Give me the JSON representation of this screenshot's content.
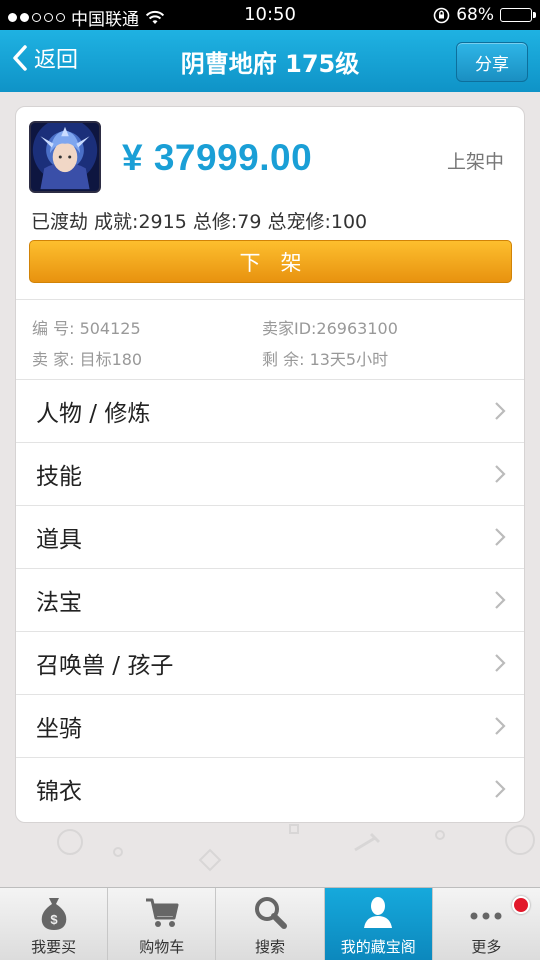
{
  "status_bar": {
    "carrier": "中国联通",
    "time": "10:50",
    "battery": "68%",
    "battery_level": 0.68
  },
  "nav": {
    "back_label": "返回",
    "title": "阴曹地府 175级",
    "share_label": "分享"
  },
  "item": {
    "price": "¥ 37999.00",
    "status": "上架中",
    "stats": "已渡劫  成就:2915  总修:79  总宠修:100",
    "action_label": "下架"
  },
  "meta": {
    "id_label": "编  号: 504125",
    "seller_id_label": "卖家ID:26963100",
    "seller_label": "卖  家: 目标180",
    "remaining_label": "剩  余: 13天5小时"
  },
  "menu": [
    {
      "label": "人物 / 修炼"
    },
    {
      "label": "技能"
    },
    {
      "label": "道具"
    },
    {
      "label": "法宝"
    },
    {
      "label": "召唤兽 / 孩子"
    },
    {
      "label": "坐骑"
    },
    {
      "label": "锦衣"
    }
  ],
  "tabs": [
    {
      "label": "我要买",
      "icon": "money-bag-icon"
    },
    {
      "label": "购物车",
      "icon": "cart-icon"
    },
    {
      "label": "搜索",
      "icon": "search-icon"
    },
    {
      "label": "我的藏宝阁",
      "icon": "user-icon"
    },
    {
      "label": "更多",
      "icon": "more-icon"
    }
  ],
  "colors": {
    "nav": "#1fb2e2",
    "price": "#1a9fd6",
    "action_button": "#f3a61a",
    "tab_active": "#0f97cc",
    "badge": "#e2182a"
  }
}
